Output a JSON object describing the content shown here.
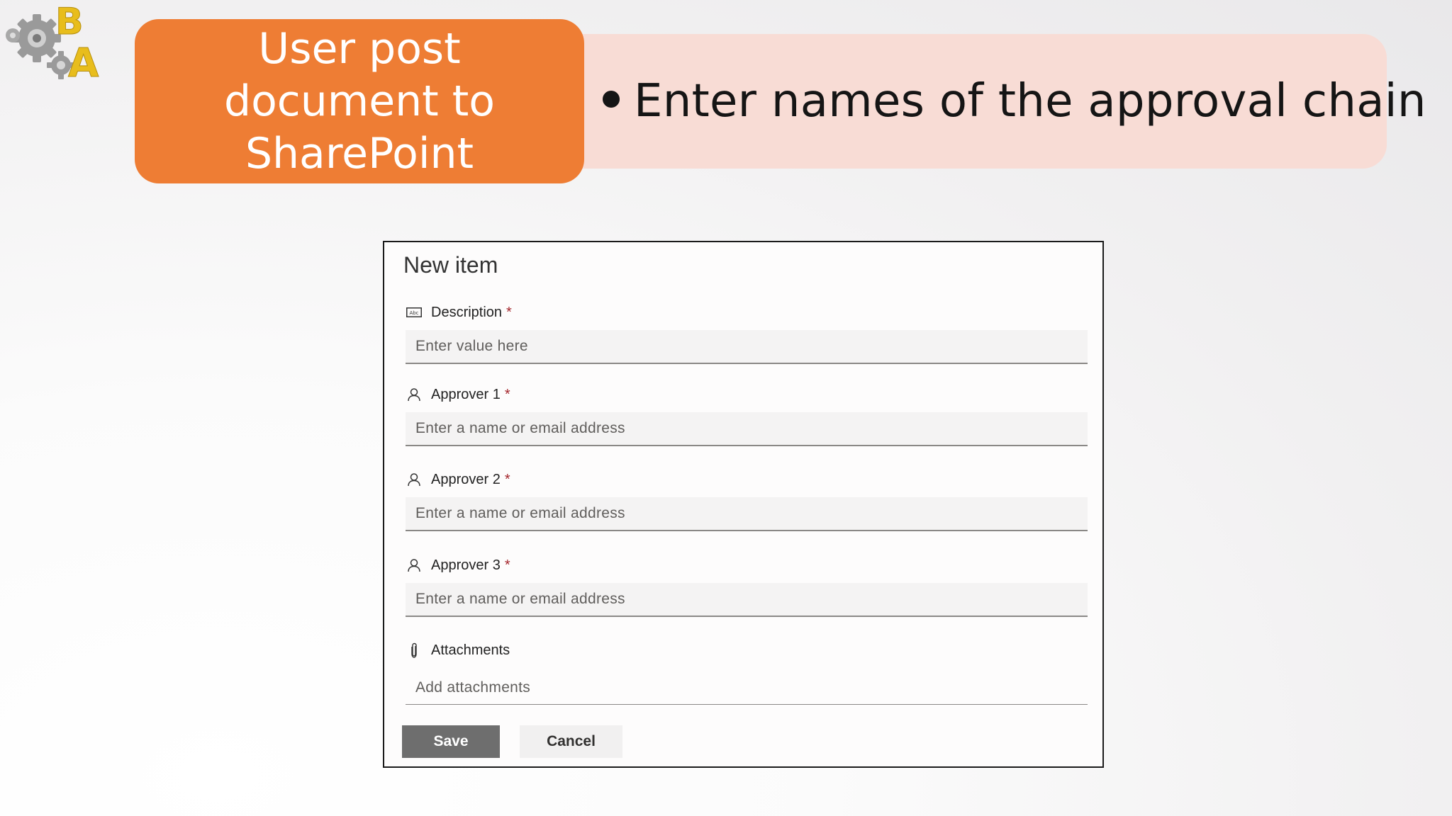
{
  "logo": {
    "letters": [
      "B",
      "A"
    ],
    "icon": "gears-logo-icon",
    "colors": {
      "letters": "#e8bd1c",
      "gears": "#8f8f8f"
    }
  },
  "slide": {
    "title": "User post document to SharePoint",
    "bullet": "Enter names of the approval chain",
    "colors": {
      "title_bg": "#ee7d34",
      "bullet_bg": "#f8dcd5"
    }
  },
  "form": {
    "title": "New item",
    "required_marker": "*",
    "fields": [
      {
        "label": "Description",
        "placeholder": "Enter value here",
        "icon": "text-field-icon",
        "required": true
      },
      {
        "label": "Approver 1",
        "placeholder": "Enter a name or email address",
        "icon": "person-icon",
        "required": true
      },
      {
        "label": "Approver 2",
        "placeholder": "Enter a name or email address",
        "icon": "person-icon",
        "required": true
      },
      {
        "label": "Approver 3",
        "placeholder": "Enter a name or email address",
        "icon": "person-icon",
        "required": true
      }
    ],
    "attachments": {
      "label": "Attachments",
      "action": "Add attachments",
      "icon": "paperclip-icon"
    },
    "buttons": {
      "save": "Save",
      "cancel": "Cancel"
    },
    "colors": {
      "required": "#a4262c",
      "save_bg": "#6e6e6e"
    }
  }
}
